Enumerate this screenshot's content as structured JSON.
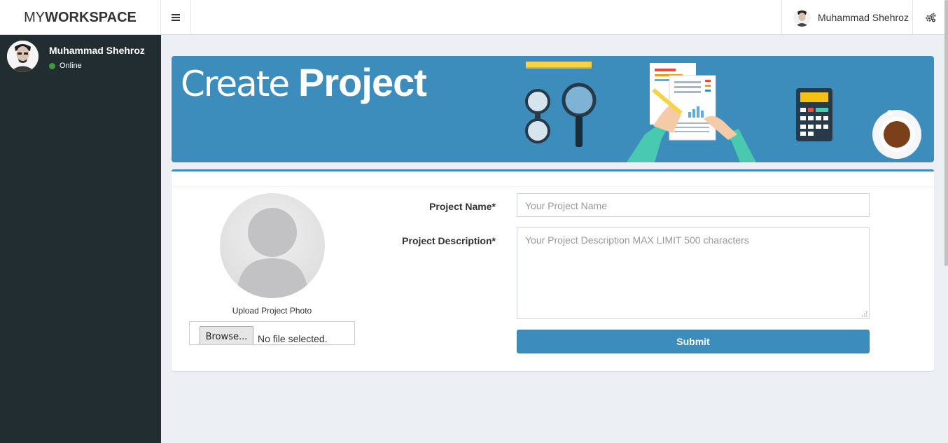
{
  "header": {
    "logo_prefix": "MY",
    "logo_bold": "WORKSPACE",
    "user_name": "Muhammad Shehroz"
  },
  "sidebar": {
    "user_name": "Muhammad Shehroz",
    "status": "Online"
  },
  "banner": {
    "title_light": "Create ",
    "title_bold": "Project"
  },
  "form": {
    "upload_label": "Upload Project Photo",
    "browse_label": "Browse...",
    "file_status": "No file selected.",
    "project_name_label": "Project Name*",
    "project_name_placeholder": "Your Project Name",
    "project_desc_label": "Project Description*",
    "project_desc_placeholder": "Your Project Description MAX LIMIT 500 characters",
    "submit_label": "Submit"
  },
  "colors": {
    "accent": "#3c8dbc",
    "sidebar_bg": "#222d32",
    "status_online": "#3c9a3c"
  }
}
